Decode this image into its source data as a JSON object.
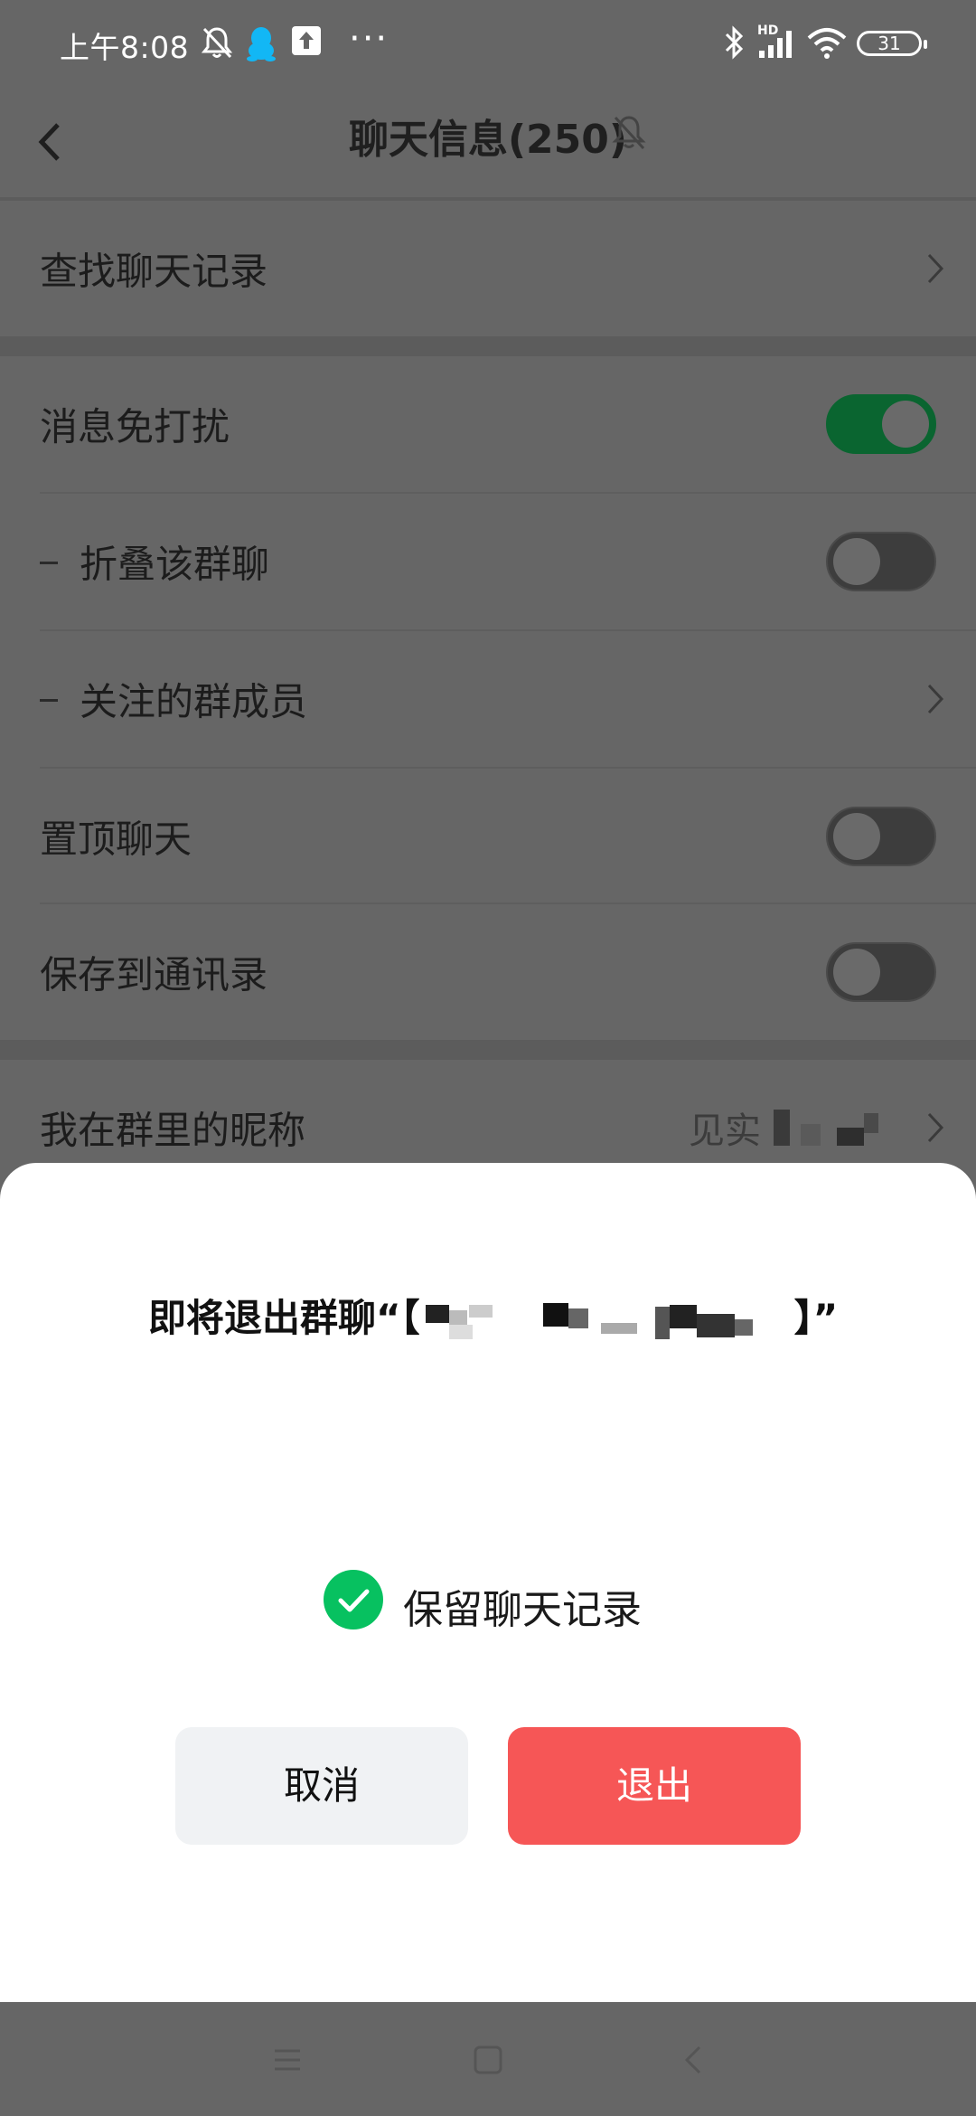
{
  "status_bar": {
    "time": "上午8:08",
    "overflow": "···",
    "network": "HD",
    "battery": "31"
  },
  "header": {
    "title": "聊天信息(250)"
  },
  "list": {
    "search_history": "查找聊天记录",
    "mute_notifications": "消息免打扰",
    "mute_on": true,
    "fold_chat": "折叠该群聊",
    "fold_on": false,
    "followed_members": "关注的群成员",
    "pin_chat": "置顶聊天",
    "pin_on": false,
    "save_contacts": "保存到通讯录",
    "save_on": false,
    "my_nickname": "我在群里的昵称",
    "my_nickname_value": "见实"
  },
  "dialog": {
    "title_prefix": "即将退出群聊“【",
    "title_suffix": "】”",
    "keep_history_label": "保留聊天记录",
    "keep_history_checked": true,
    "cancel_label": "取消",
    "exit_label": "退出"
  },
  "colors": {
    "accent_green": "#07c160",
    "danger_red": "#f65656",
    "toggle_on": "#0a6530"
  }
}
